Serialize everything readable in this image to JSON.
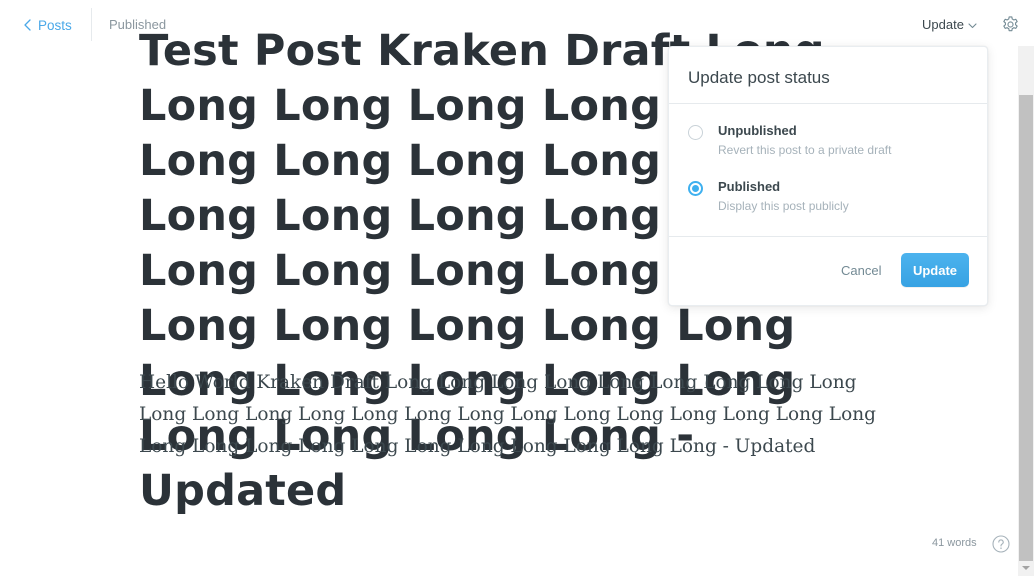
{
  "topbar": {
    "back_label": "Posts",
    "status": "Published",
    "update_menu_label": "Update"
  },
  "post": {
    "title": "Test Post Kraken Draft Long Long Long Long Long Long Long Long Long Long Long Long Long Long Long Long Long Long Long Long Long Long Long Long Long Long Long Long Long Long Long Long Long Long Long - Updated",
    "body": "Hello World Kraken Draft Long Long Long Long Long Long Long Long Long Long Long Long Long Long Long Long Long Long Long Long Long Long Long Long Long Long Long Long Long Long Long Long Long Long - Updated"
  },
  "popover": {
    "title": "Update post status",
    "options": [
      {
        "label": "Unpublished",
        "description": "Revert this post to a private draft",
        "selected": false
      },
      {
        "label": "Published",
        "description": "Display this post publicly",
        "selected": true
      }
    ],
    "cancel_label": "Cancel",
    "update_label": "Update"
  },
  "footer": {
    "word_count": "41 words"
  },
  "colors": {
    "accent": "#3eb0ef",
    "text_dark": "#2b3238",
    "text_muted": "#a6b2ba"
  },
  "icons": {
    "back": "chevron-left-icon",
    "dropdown": "chevron-down-icon",
    "settings": "gear-icon",
    "help": "question-circle-icon"
  }
}
